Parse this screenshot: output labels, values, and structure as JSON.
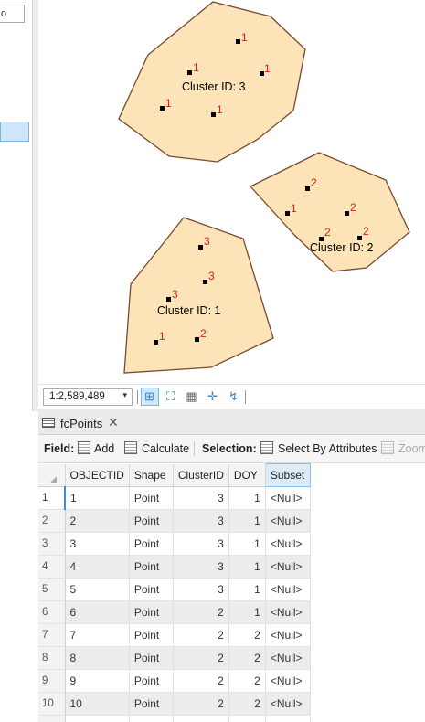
{
  "left_panel": {
    "dropdown_text": "o"
  },
  "map": {
    "clusters": [
      {
        "label": "Cluster ID: 3"
      },
      {
        "label": "Cluster ID: 2"
      },
      {
        "label": "Cluster ID: 1"
      }
    ],
    "point_labels": [
      "1",
      "1",
      "1",
      "1",
      "1",
      "2",
      "2",
      "2",
      "2",
      "3",
      "3",
      "3",
      "1",
      "2"
    ],
    "colors": {
      "polygon_fill": "#fde3b8",
      "polygon_stroke": "#7a4a2e",
      "point_label": "#e01a1a"
    }
  },
  "map_status": {
    "scale": "1:2,589,489"
  },
  "table_tab": {
    "name": "fcPoints"
  },
  "table_toolbar": {
    "field_label": "Field:",
    "add_label": "Add",
    "calculate_label": "Calculate",
    "selection_label": "Selection:",
    "select_by_attributes_label": "Select By Attributes",
    "zoom_label": "Zoom"
  },
  "table": {
    "columns": [
      "OBJECTID",
      "Shape",
      "ClusterID",
      "DOY",
      "Subset"
    ],
    "rows": [
      {
        "n": "1",
        "objectid": "1",
        "shape": "Point",
        "clusterid": "3",
        "doy": "1",
        "subset": "<Null>"
      },
      {
        "n": "2",
        "objectid": "2",
        "shape": "Point",
        "clusterid": "3",
        "doy": "1",
        "subset": "<Null>"
      },
      {
        "n": "3",
        "objectid": "3",
        "shape": "Point",
        "clusterid": "3",
        "doy": "1",
        "subset": "<Null>"
      },
      {
        "n": "4",
        "objectid": "4",
        "shape": "Point",
        "clusterid": "3",
        "doy": "1",
        "subset": "<Null>"
      },
      {
        "n": "5",
        "objectid": "5",
        "shape": "Point",
        "clusterid": "3",
        "doy": "1",
        "subset": "<Null>"
      },
      {
        "n": "6",
        "objectid": "6",
        "shape": "Point",
        "clusterid": "2",
        "doy": "1",
        "subset": "<Null>"
      },
      {
        "n": "7",
        "objectid": "7",
        "shape": "Point",
        "clusterid": "2",
        "doy": "2",
        "subset": "<Null>"
      },
      {
        "n": "8",
        "objectid": "8",
        "shape": "Point",
        "clusterid": "2",
        "doy": "2",
        "subset": "<Null>"
      },
      {
        "n": "9",
        "objectid": "9",
        "shape": "Point",
        "clusterid": "2",
        "doy": "2",
        "subset": "<Null>"
      },
      {
        "n": "10",
        "objectid": "10",
        "shape": "Point",
        "clusterid": "2",
        "doy": "2",
        "subset": "<Null>"
      }
    ]
  }
}
